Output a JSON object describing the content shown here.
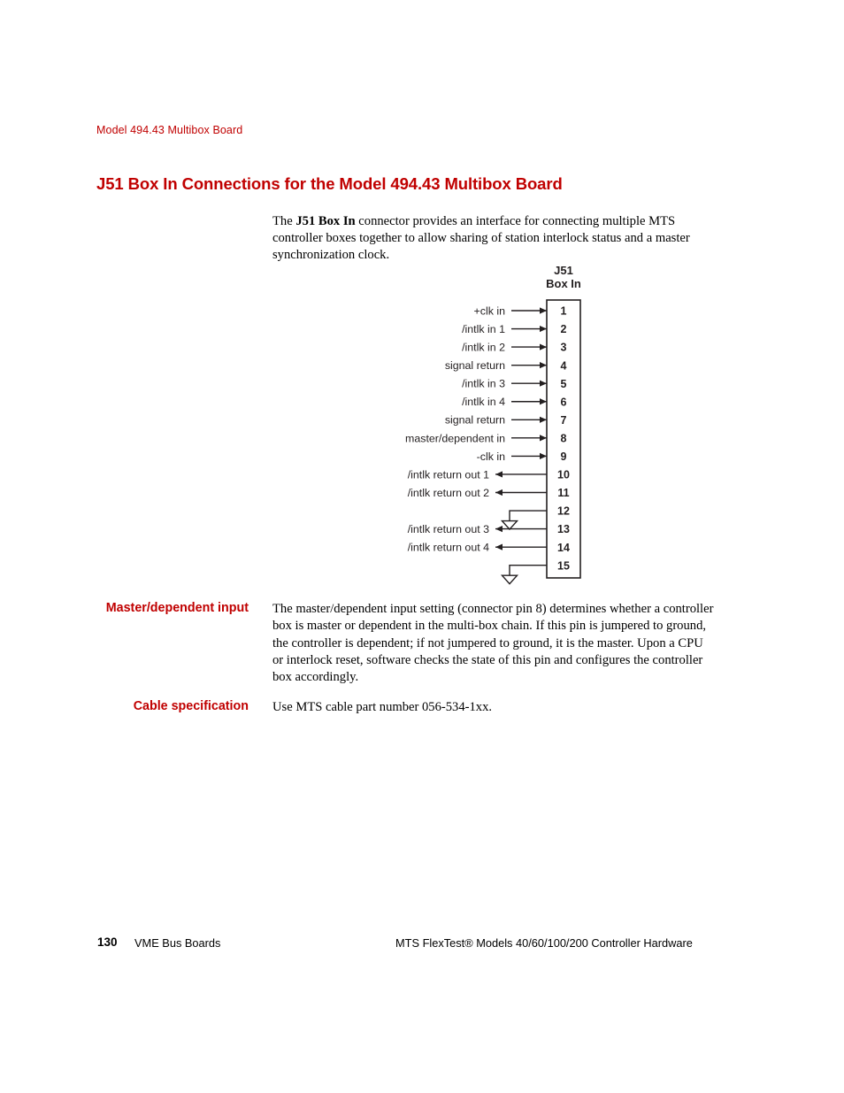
{
  "running_head": "Model 494.43 Multibox Board",
  "section_title": "J51 Box In Connections for the Model 494.43 Multibox Board",
  "intro": {
    "lead": "The ",
    "bold": "J51 Box In",
    "rest": " connector provides an interface for connecting multiple MTS controller boxes together to allow sharing of station interlock status and a master synchronization clock."
  },
  "diagram": {
    "connector_title_line1": "J51",
    "connector_title_line2": "Box In",
    "pins": [
      {
        "number": "1",
        "label": "+clk in",
        "direction": "in"
      },
      {
        "number": "2",
        "label": "/intlk in 1",
        "direction": "in"
      },
      {
        "number": "3",
        "label": "/intlk in 2",
        "direction": "in"
      },
      {
        "number": "4",
        "label": "signal return",
        "direction": "in"
      },
      {
        "number": "5",
        "label": "/intlk in 3",
        "direction": "in"
      },
      {
        "number": "6",
        "label": "/intlk in 4",
        "direction": "in"
      },
      {
        "number": "7",
        "label": "signal return",
        "direction": "in"
      },
      {
        "number": "8",
        "label": "master/dependent in",
        "direction": "in"
      },
      {
        "number": "9",
        "label": "-clk in",
        "direction": "in"
      },
      {
        "number": "10",
        "label": "/intlk return out 1",
        "direction": "out"
      },
      {
        "number": "11",
        "label": "/intlk return out 2",
        "direction": "out"
      },
      {
        "number": "12",
        "label": "",
        "direction": "ground"
      },
      {
        "number": "13",
        "label": "/intlk return out 3",
        "direction": "out"
      },
      {
        "number": "14",
        "label": "/intlk return out 4",
        "direction": "out"
      },
      {
        "number": "15",
        "label": "",
        "direction": "ground"
      }
    ]
  },
  "sections": [
    {
      "heading": "Master/dependent input",
      "body": "The master/dependent input setting (connector pin 8) determines whether a controller box is master or dependent in the multi-box chain. If this pin is jumpered to ground, the controller is dependent; if not jumpered to ground, it is the master. Upon a CPU or interlock reset, software checks the state of this pin and configures the controller box accordingly."
    },
    {
      "heading": "Cable specification",
      "body": "Use MTS cable part number 056-534-1xx."
    }
  ],
  "footer": {
    "page_number": "130",
    "left_text": "VME Bus Boards",
    "right_text": "MTS FlexTest® Models 40/60/100/200 Controller Hardware"
  },
  "colors": {
    "heading_red": "#C00000",
    "text_black": "#000000",
    "diagram_line": "#231f20",
    "page_background": "#ffffff"
  }
}
